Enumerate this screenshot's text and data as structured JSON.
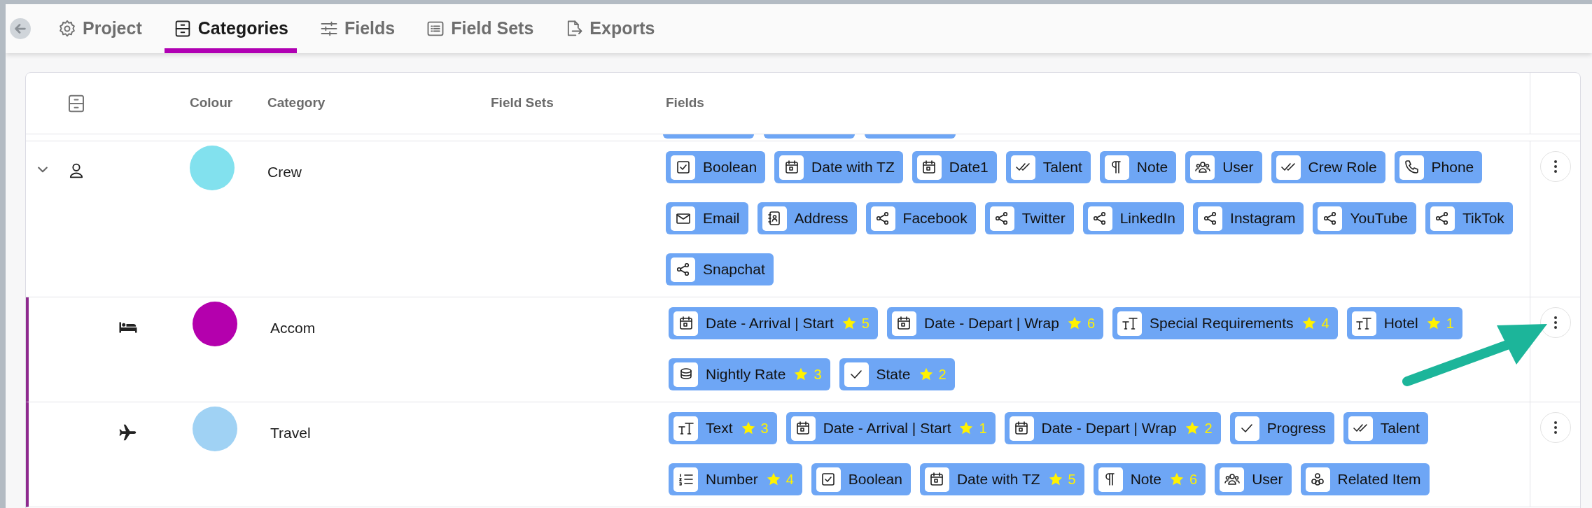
{
  "tabs": [
    {
      "label": "Project",
      "kind": "gear",
      "selected": false
    },
    {
      "label": "Categories",
      "kind": "cabinet",
      "selected": true
    },
    {
      "label": "Fields",
      "kind": "sliders",
      "selected": false
    },
    {
      "label": "Field Sets",
      "kind": "list",
      "selected": false
    },
    {
      "label": "Exports",
      "kind": "export",
      "selected": false
    }
  ],
  "table": {
    "columns": [
      "Colour",
      "Category",
      "Field Sets",
      "Fields"
    ],
    "rows": [
      {
        "name": "Crew",
        "kind": "person",
        "color": "#82e1ee",
        "expanded": true,
        "fields": [
          {
            "label": "Boolean",
            "kind": "boolean"
          },
          {
            "label": "Date with TZ",
            "kind": "date"
          },
          {
            "label": "Date1",
            "kind": "date"
          },
          {
            "label": "Talent",
            "kind": "talent"
          },
          {
            "label": "Note",
            "kind": "note"
          },
          {
            "label": "User",
            "kind": "user"
          },
          {
            "label": "Crew Role",
            "kind": "talent"
          },
          {
            "label": "Phone",
            "kind": "phone"
          },
          {
            "label": "Email",
            "kind": "email"
          },
          {
            "label": "Address",
            "kind": "address"
          },
          {
            "label": "Facebook",
            "kind": "social"
          },
          {
            "label": "Twitter",
            "kind": "social"
          },
          {
            "label": "LinkedIn",
            "kind": "social"
          },
          {
            "label": "Instagram",
            "kind": "social"
          },
          {
            "label": "YouTube",
            "kind": "social"
          },
          {
            "label": "TikTok",
            "kind": "social"
          },
          {
            "label": "Snapchat",
            "kind": "social"
          }
        ],
        "children": [
          {
            "name": "Accom",
            "kind": "bed",
            "color": "#b400ad",
            "fields": [
              {
                "label": "Date - Arrival | Start",
                "kind": "date",
                "badge": "5"
              },
              {
                "label": "Date - Depart | Wrap",
                "kind": "date",
                "badge": "6"
              },
              {
                "label": "Special Requirements",
                "kind": "text",
                "badge": "4"
              },
              {
                "label": "Hotel",
                "kind": "text",
                "badge": "1"
              },
              {
                "label": "Nightly Rate",
                "kind": "currency",
                "badge": "3"
              },
              {
                "label": "State",
                "kind": "check",
                "badge": "2"
              }
            ]
          },
          {
            "name": "Travel",
            "kind": "plane",
            "color": "#a0d2f4",
            "fields": [
              {
                "label": "Text",
                "kind": "text",
                "badge": "3"
              },
              {
                "label": "Date - Arrival | Start",
                "kind": "date",
                "badge": "1"
              },
              {
                "label": "Date - Depart | Wrap",
                "kind": "date",
                "badge": "2"
              },
              {
                "label": "Progress",
                "kind": "check"
              },
              {
                "label": "Talent",
                "kind": "talent"
              },
              {
                "label": "Number",
                "kind": "number",
                "badge": "4"
              },
              {
                "label": "Boolean",
                "kind": "boolean"
              },
              {
                "label": "Date with TZ",
                "kind": "date",
                "badge": "5"
              },
              {
                "label": "Note",
                "kind": "note",
                "badge": "6"
              },
              {
                "label": "User",
                "kind": "user"
              },
              {
                "label": "Related Item",
                "kind": "relation"
              }
            ]
          }
        ]
      }
    ]
  }
}
